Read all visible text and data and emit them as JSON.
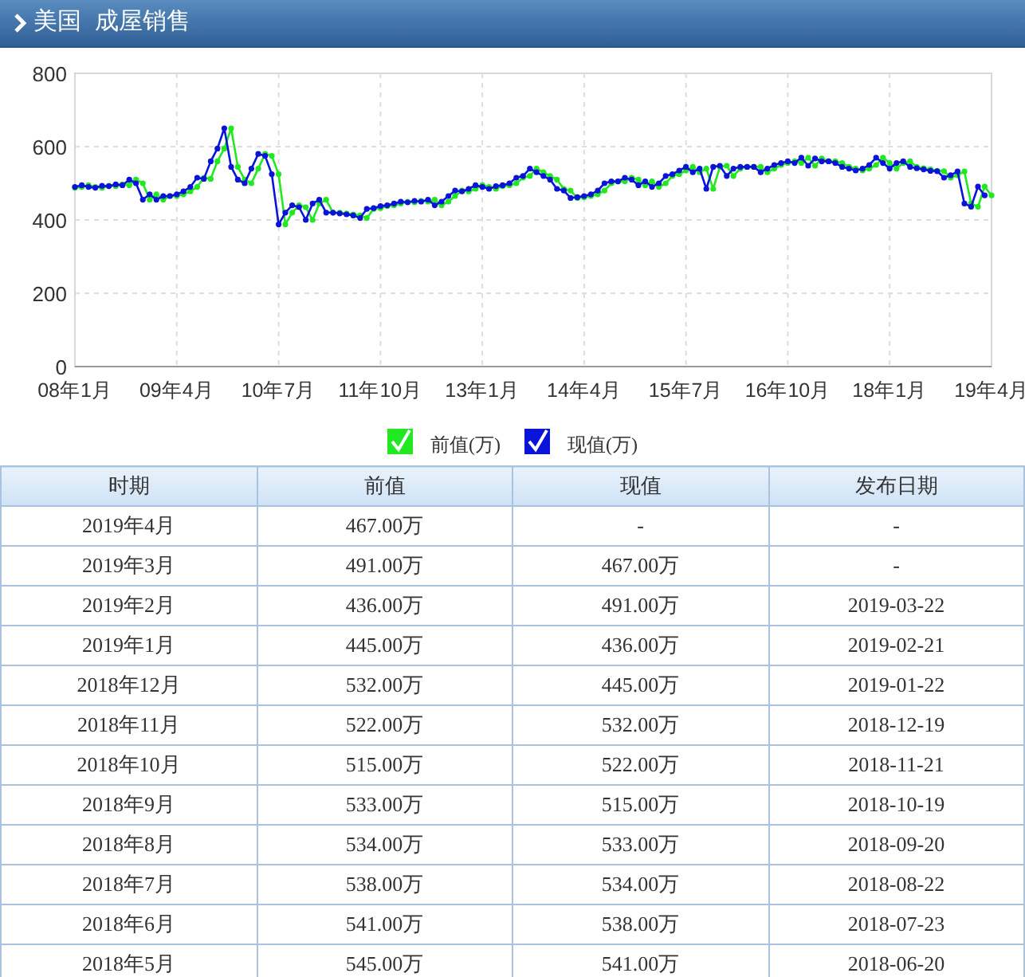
{
  "header": {
    "title": "美国  成屋销售"
  },
  "chart": {
    "chart_data": {
      "type": "line",
      "categories": [
        "08年1月",
        null,
        null,
        null,
        null,
        null,
        null,
        null,
        null,
        null,
        null,
        null,
        null,
        null,
        null,
        "09年4月",
        null,
        null,
        null,
        null,
        null,
        null,
        null,
        null,
        null,
        null,
        null,
        null,
        null,
        null,
        "10年7月",
        null,
        null,
        null,
        null,
        null,
        null,
        null,
        null,
        null,
        null,
        null,
        null,
        null,
        null,
        "11年10月",
        null,
        null,
        null,
        null,
        null,
        null,
        null,
        null,
        null,
        null,
        null,
        null,
        null,
        null,
        "13年1月",
        null,
        null,
        null,
        null,
        null,
        null,
        null,
        null,
        null,
        null,
        null,
        null,
        null,
        null,
        "14年4月",
        null,
        null,
        null,
        null,
        null,
        null,
        null,
        null,
        null,
        null,
        null,
        null,
        null,
        null,
        "15年7月",
        null,
        null,
        null,
        null,
        null,
        null,
        null,
        null,
        null,
        null,
        null,
        null,
        null,
        null,
        "16年10月",
        null,
        null,
        null,
        null,
        null,
        null,
        null,
        null,
        null,
        null,
        null,
        null,
        null,
        null,
        "18年1月",
        null,
        null,
        null,
        null,
        null,
        null,
        null,
        null,
        null,
        null,
        null,
        null,
        null,
        null,
        "19年4月"
      ],
      "grid": true,
      "legend": {
        "items": [
          {
            "checked": true
          },
          {
            "checked": true
          }
        ]
      },
      "ylim": [
        0,
        800
      ],
      "yticks": [
        0,
        200,
        400,
        600,
        800
      ],
      "series": [
        {
          "name": "前值(万)",
          "color": "#22e822",
          "values": [
            488,
            490,
            495,
            490,
            488,
            493,
            492,
            497,
            495,
            510,
            500,
            455,
            470,
            455,
            465,
            465,
            470,
            478,
            490,
            515,
            512,
            560,
            595,
            650,
            545,
            510,
            500,
            540,
            580,
            575,
            525,
            388,
            420,
            440,
            435,
            400,
            445,
            455,
            420,
            420,
            418,
            415,
            412,
            405,
            430,
            432,
            438,
            440,
            445,
            450,
            448,
            452,
            450,
            455,
            440,
            450,
            465,
            480,
            478,
            485,
            495,
            490,
            485,
            492,
            495,
            500,
            515,
            520,
            540,
            530,
            520,
            510,
            485,
            480,
            460,
            462,
            465,
            470,
            480,
            500,
            505,
            505,
            515,
            510,
            495,
            505,
            490,
            500,
            520,
            525,
            535,
            545,
            530,
            540,
            485,
            545,
            548,
            520,
            540,
            545,
            545,
            545,
            530,
            540,
            550,
            555,
            560,
            555,
            570,
            548,
            568,
            560,
            560,
            555,
            545,
            540,
            535,
            540,
            550,
            570,
            555,
            540,
            555,
            560,
            545,
            541,
            538,
            534,
            533,
            515,
            522,
            532,
            445,
            436,
            491,
            467
          ]
        },
        {
          "name": "现值(万)",
          "color": "#0a14d8",
          "values": [
            490,
            495,
            490,
            488,
            493,
            492,
            497,
            495,
            510,
            500,
            455,
            470,
            455,
            465,
            465,
            470,
            478,
            490,
            515,
            512,
            560,
            595,
            650,
            545,
            510,
            500,
            540,
            580,
            575,
            525,
            388,
            420,
            440,
            435,
            400,
            445,
            455,
            420,
            420,
            418,
            415,
            412,
            405,
            430,
            432,
            438,
            440,
            445,
            450,
            448,
            452,
            450,
            455,
            440,
            450,
            465,
            480,
            478,
            485,
            495,
            490,
            485,
            492,
            495,
            500,
            515,
            520,
            540,
            530,
            520,
            510,
            485,
            480,
            460,
            462,
            465,
            470,
            480,
            500,
            505,
            505,
            515,
            510,
            495,
            505,
            490,
            500,
            520,
            525,
            535,
            545,
            530,
            540,
            485,
            545,
            548,
            520,
            540,
            545,
            545,
            545,
            530,
            540,
            550,
            555,
            560,
            555,
            570,
            548,
            568,
            560,
            560,
            555,
            545,
            540,
            535,
            540,
            550,
            570,
            555,
            540,
            555,
            560,
            545,
            541,
            538,
            534,
            533,
            515,
            522,
            532,
            445,
            436,
            491,
            467,
            null
          ]
        }
      ]
    }
  },
  "table": {
    "columns": [
      "时期",
      "前值",
      "现值",
      "发布日期"
    ],
    "rows": [
      [
        "2019年4月",
        "467.00万",
        "-",
        "-"
      ],
      [
        "2019年3月",
        "491.00万",
        "467.00万",
        "-"
      ],
      [
        "2019年2月",
        "436.00万",
        "491.00万",
        "2019-03-22"
      ],
      [
        "2019年1月",
        "445.00万",
        "436.00万",
        "2019-02-21"
      ],
      [
        "2018年12月",
        "532.00万",
        "445.00万",
        "2019-01-22"
      ],
      [
        "2018年11月",
        "522.00万",
        "532.00万",
        "2018-12-19"
      ],
      [
        "2018年10月",
        "515.00万",
        "522.00万",
        "2018-11-21"
      ],
      [
        "2018年9月",
        "533.00万",
        "515.00万",
        "2018-10-19"
      ],
      [
        "2018年8月",
        "534.00万",
        "533.00万",
        "2018-09-20"
      ],
      [
        "2018年7月",
        "538.00万",
        "534.00万",
        "2018-08-22"
      ],
      [
        "2018年6月",
        "541.00万",
        "538.00万",
        "2018-07-23"
      ],
      [
        "2018年5月",
        "545.00万",
        "541.00万",
        "2018-06-20"
      ]
    ]
  }
}
